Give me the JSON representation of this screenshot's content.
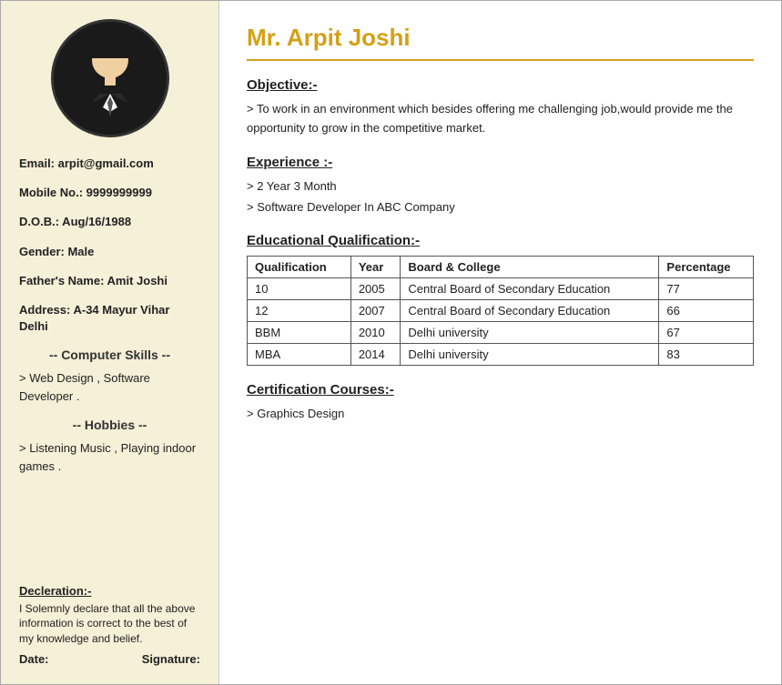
{
  "sidebar": {
    "email_label": "Email: arpit@gmail.com",
    "mobile_label": "Mobile No.: 9999999999",
    "dob_label": "D.O.B.: Aug/16/1988",
    "gender_label": "Gender: Male",
    "father_label": "Father's Name: Amit Joshi",
    "address_label": "Address: A-34 Mayur Vihar Delhi",
    "computer_skills_heading": "-- Computer Skills --",
    "computer_skills_text": "> Web Design , Software Developer .",
    "hobbies_heading": "-- Hobbies --",
    "hobbies_text": "> Listening Music , Playing indoor games .",
    "declaration_title": "Decleration:-",
    "declaration_text": "I Solemnly declare that all the above information is correct to the best of my knowledge and belief.",
    "date_label": "Date:",
    "signature_label": "Signature:"
  },
  "main": {
    "candidate_name": "Mr. Arpit Joshi",
    "objective_title": "Objective:-",
    "objective_text": "> To work in an environment which besides offering me challenging job,would provide me the opportunity to grow in the competitive market.",
    "experience_title": "Experience :-",
    "experience_items": [
      "> 2 Year 3 Month",
      "> Software Developer In ABC Company"
    ],
    "education_title": "Educational Qualification:-",
    "education_table": {
      "headers": [
        "Qualification",
        "Year",
        "Board & College",
        "Percentage"
      ],
      "rows": [
        [
          "10",
          "2005",
          "Central Board of Secondary Education",
          "77"
        ],
        [
          "12",
          "2007",
          "Central Board of Secondary Education",
          "66"
        ],
        [
          "BBM",
          "2010",
          "Delhi university",
          "67"
        ],
        [
          "MBA",
          "2014",
          "Delhi university",
          "83"
        ]
      ]
    },
    "certification_title": "Certification Courses:-",
    "certification_items": [
      ">   Graphics Design"
    ]
  }
}
